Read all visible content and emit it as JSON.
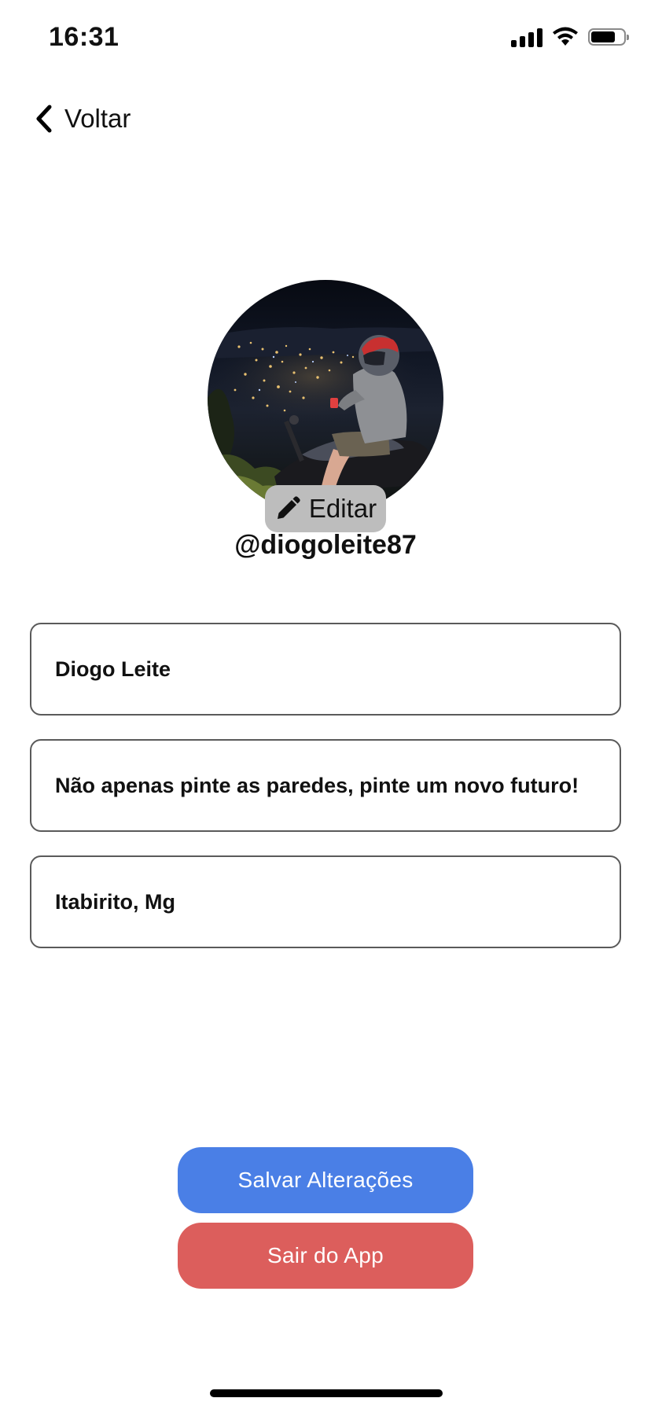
{
  "status_bar": {
    "time": "16:31",
    "battery_level": 0.75,
    "icons": [
      "signal-icon",
      "wifi-icon",
      "battery-icon"
    ]
  },
  "nav": {
    "back_label": "Voltar",
    "back_icon": "chevron-left-icon"
  },
  "profile": {
    "avatar_icon": "avatar-photo",
    "edit_label": "Editar",
    "edit_icon": "pencil-icon",
    "username": "@diogoleite87"
  },
  "form": {
    "name_value": "Diogo Leite",
    "bio_value": "Não apenas pinte as paredes, pinte um novo futuro!",
    "location_value": "Itabirito, Mg"
  },
  "actions": {
    "save_label": "Salvar Alterações",
    "logout_label": "Sair do App"
  },
  "colors": {
    "save_button": "#4a7fe6",
    "logout_button": "#dc5e5c",
    "edit_chip": "#bdbdbd",
    "field_border": "#5a5a5a"
  }
}
